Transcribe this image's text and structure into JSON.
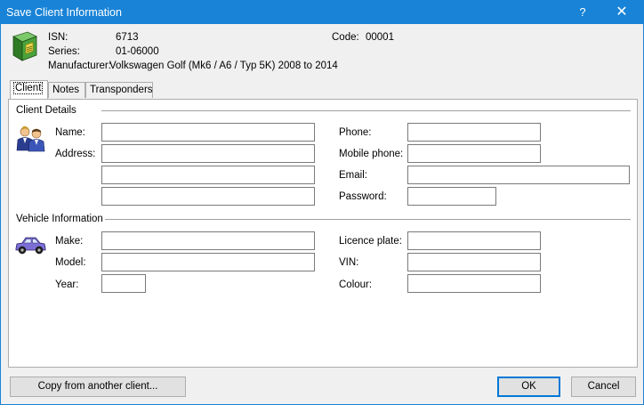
{
  "window": {
    "title": "Save Client Information",
    "help_label": "?",
    "close_label": "✕"
  },
  "header": {
    "isn_label": "ISN:",
    "isn_value": "6713",
    "series_label": "Series:",
    "series_value": "01-06000",
    "manufacturer_label": "Manufacturer:",
    "manufacturer_value": "Volkswagen Golf (Mk6 / A6 / Typ 5K) 2008 to 2014",
    "code_label": "Code:",
    "code_value": "00001",
    "icon": "green-book-icon"
  },
  "tabs": [
    {
      "label": "Client",
      "active": true
    },
    {
      "label": "Notes",
      "active": false
    },
    {
      "label": "Transponders",
      "active": false
    }
  ],
  "client_details": {
    "section_label": "Client Details",
    "icon": "people-icon",
    "name_label": "Name:",
    "address_label": "Address:",
    "phone_label": "Phone:",
    "mobile_label": "Mobile phone:",
    "email_label": "Email:",
    "password_label": "Password:",
    "name_value": "",
    "address_line1": "",
    "address_line2": "",
    "address_line3": "",
    "phone_value": "",
    "mobile_value": "",
    "email_value": "",
    "password_value": ""
  },
  "vehicle_info": {
    "section_label": "Vehicle Information",
    "icon": "car-icon",
    "make_label": "Make:",
    "model_label": "Model:",
    "year_label": "Year:",
    "plate_label": "Licence plate:",
    "vin_label": "VIN:",
    "colour_label": "Colour:",
    "make_value": "",
    "model_value": "",
    "year_value": "",
    "plate_value": "",
    "vin_value": "",
    "colour_value": ""
  },
  "buttons": {
    "copy_label": "Copy from another client...",
    "ok_label": "OK",
    "cancel_label": "Cancel"
  },
  "colors": {
    "titlebar": "#1883d7",
    "book_green": "#3f8f2f",
    "car_purple": "#6a5acd"
  }
}
